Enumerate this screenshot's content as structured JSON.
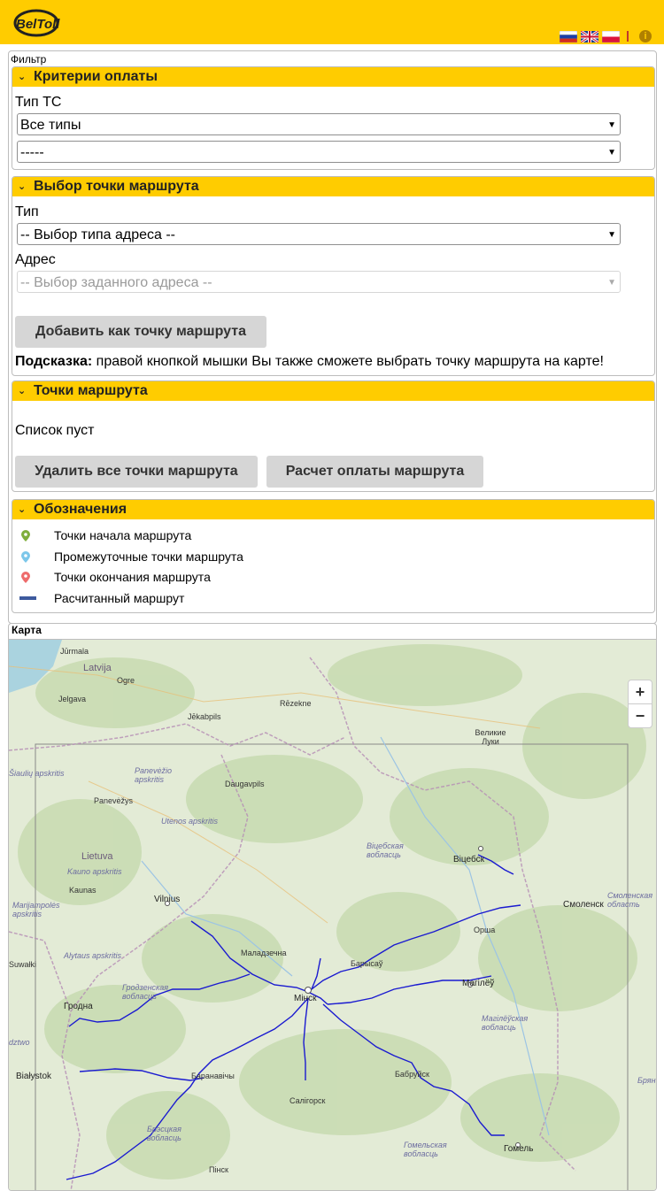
{
  "header": {
    "logo_text": "BelToll",
    "flags": [
      "ru",
      "gb",
      "pl"
    ]
  },
  "filter": {
    "legend": "Фильтр",
    "payment": {
      "title": "Критерии оплаты",
      "vehicle_label": "Тип ТС",
      "vehicle_value": "Все типы",
      "subtype_value": "-----"
    },
    "point_select": {
      "title": "Выбор точки маршрута",
      "type_label": "Тип",
      "type_value": "-- Выбор типа адреса --",
      "address_label": "Адрес",
      "address_value": "-- Выбор заданного адреса --",
      "add_button": "Добавить как точку маршрута",
      "hint_bold": "Подсказка:",
      "hint_text": " правой кнопкой мышки Вы также сможете выбрать точку маршрута на карте!"
    },
    "route_points": {
      "title": "Точки маршрута",
      "empty": "Список пуст",
      "delete_all": "Удалить все точки маршрута",
      "calculate": "Расчет оплаты маршрута"
    },
    "legend_section": {
      "title": "Обозначения",
      "items": [
        {
          "label": "Точки начала маршрута",
          "color": "#7fae3c"
        },
        {
          "label": "Промежуточные точки маршрута",
          "color": "#7cc7ea"
        },
        {
          "label": "Точки окончания маршрута",
          "color": "#ee6b6b"
        },
        {
          "label": "Расчитанный маршрут",
          "color": "#3d5a9e"
        }
      ]
    }
  },
  "map": {
    "title": "Карта",
    "zoom_in": "+",
    "zoom_out": "−",
    "labels": {
      "jurmala": "Jūrmala",
      "latvija": "Latvija",
      "ogre": "Ogre",
      "jelgava": "Jelgava",
      "rezekne": "Rēzekne",
      "jekabpils": "Jēkabpils",
      "velikie_luki": "Великие Луки",
      "siauliu": "Šiaulių apskritis",
      "panevezio_apskritis": "Panevėžio apskritis",
      "daugavpils": "Daugavpils",
      "panevezys": "Panevėžys",
      "utenos": "Utenos apskritis",
      "lietuva": "Lietuva",
      "kauno": "Kauno apskritis",
      "kaunas": "Kaunas",
      "vilnius": "Vilnius",
      "marijampoles": "Marijampolės apskritis",
      "alytaus": "Alytaus apskritis",
      "suwalki": "Suwałki",
      "vitebsk_obl": "Віцебская вобласць",
      "vitebsk": "Віцебск",
      "smolensk": "Смоленск",
      "smolensk_obl": "Смоленская область",
      "orsha": "Орша",
      "maladzechna": "Маладзечна",
      "barysau": "Барысаў",
      "minsk": "Мінск",
      "mahileu": "Магілёў",
      "hrodna_obl": "Гродзенская вобласць",
      "hrodna": "Гродна",
      "mahileu_obl": "Магілёўская вобласць",
      "dztwo": "dztwo",
      "bialystok": "Białystok",
      "baranavichy": "Баранавічы",
      "babruisk": "Бабруйск",
      "salihorsk": "Салігорск",
      "bryansk": "Брян",
      "brest_obl": "Брэсцкая вобласць",
      "homel_obl": "Гомельская вобласць",
      "homel": "Гомель",
      "pinsk": "Пінск"
    }
  }
}
